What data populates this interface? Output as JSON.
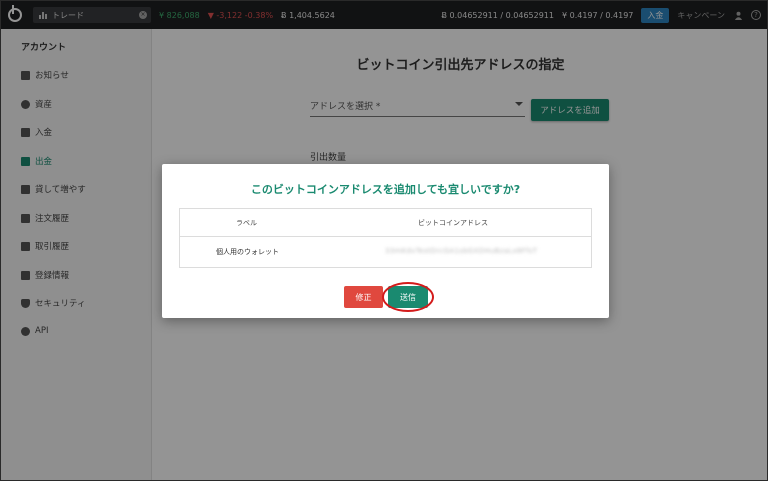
{
  "topbar": {
    "trade_label": "トレード",
    "jpy_balance": "¥ 826,088",
    "jpy_change": "▼ -3,122 -0.38%",
    "btc_balance": "Ƀ 1,404.5624",
    "btc_pair": "Ƀ 0.04652911 / 0.04652911",
    "jpy_pair": "¥ 0.4197 / 0.4197",
    "deposit_label": "入金",
    "campaign_label": "キャンペーン",
    "help_label": "?"
  },
  "sidebar": {
    "title": "アカウント",
    "items": [
      {
        "label": "お知らせ",
        "icon": "notice-icon"
      },
      {
        "label": "資産",
        "icon": "asset-icon"
      },
      {
        "label": "入金",
        "icon": "bank-icon"
      },
      {
        "label": "出金",
        "icon": "withdraw-icon",
        "active": true
      },
      {
        "label": "貸して増やす",
        "icon": "lending-icon"
      },
      {
        "label": "注文履歴",
        "icon": "order-history-icon"
      },
      {
        "label": "取引履歴",
        "icon": "trade-history-icon"
      },
      {
        "label": "登録情報",
        "icon": "profile-icon"
      },
      {
        "label": "セキュリティ",
        "icon": "shield-icon"
      },
      {
        "label": "API",
        "icon": "gear-icon"
      }
    ]
  },
  "main": {
    "title": "ビットコイン引出先アドレスの指定",
    "address_placeholder": "アドレスを選択 *",
    "add_address_label": "アドレスを追加",
    "amount_label": "引出数量"
  },
  "modal": {
    "title": "このビットコインアドレスを追加しても宜しいですか?",
    "columns": [
      "ラベル",
      "ビットコインアドレス"
    ],
    "row_label": "個人用のウォレット",
    "row_address": "33mKdvTestDrcGA1sbGXDHuBzaLx8FfsT",
    "fix_label": "修正",
    "send_label": "送信"
  },
  "colors": {
    "accent": "#1a8a70",
    "danger": "#e0483e",
    "highlight_circle": "#d31b1b",
    "topbar": "#1e1f21"
  }
}
